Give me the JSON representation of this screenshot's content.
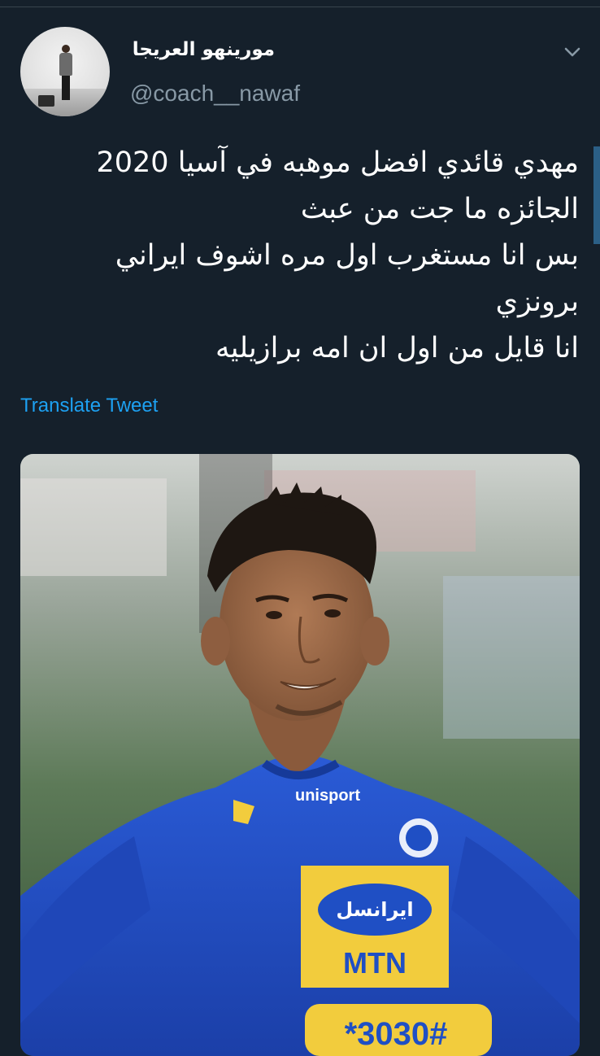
{
  "header": {
    "display_name": "مورينهو العريجا",
    "handle": "@coach__nawaf"
  },
  "tweet": {
    "lines": [
      "مهدي قائدي افضل موهبه في آسيا 2020",
      "الجائزه ما جت من عبث",
      "بس انا مستغرب اول مره اشوف ايراني",
      "برونزي",
      "انا قايل من اول ان امه برازيليه"
    ],
    "translate_label": "Translate Tweet"
  },
  "media": {
    "jersey_brand": "unisport",
    "sponsor_persian": "ایرانسل",
    "sponsor_brand": "MTN",
    "number_text": "*3030#"
  },
  "colors": {
    "background": "#15202b",
    "link": "#1da1f2",
    "muted": "#8899a6",
    "jersey_blue": "#1f4fc4",
    "sponsor_yellow": "#f2cc3d"
  },
  "icons": {
    "caret": "chevron-down-icon"
  }
}
